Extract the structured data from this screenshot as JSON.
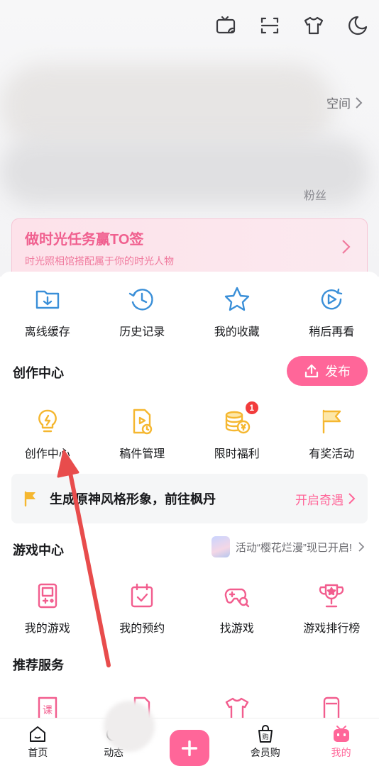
{
  "header": {
    "space_label": "空间",
    "fans_label": "粉丝"
  },
  "top_icons": [
    "tv-cast-icon",
    "scan-icon",
    "shirt-icon",
    "moon-icon"
  ],
  "promo": {
    "title": "做时光任务赢TO签",
    "subtitle": "时光照相馆搭配属于你的时光人物"
  },
  "quick_actions": [
    {
      "label": "离线缓存",
      "icon": "download-folder-icon"
    },
    {
      "label": "历史记录",
      "icon": "history-clock-icon"
    },
    {
      "label": "我的收藏",
      "icon": "star-icon"
    },
    {
      "label": "稍后再看",
      "icon": "watch-later-icon"
    }
  ],
  "creation": {
    "title": "创作中心",
    "publish_label": "发布",
    "items": [
      {
        "label": "创作中心",
        "icon": "lightbulb-icon"
      },
      {
        "label": "稿件管理",
        "icon": "video-file-icon"
      },
      {
        "label": "限时福利",
        "icon": "coins-icon",
        "badge": "1"
      },
      {
        "label": "有奖活动",
        "icon": "flag-icon"
      }
    ]
  },
  "banner": {
    "text": "生成原神风格形象，前往枫丹",
    "action": "开启奇遇"
  },
  "games": {
    "title": "游戏中心",
    "promo": "活动“樱花烂漫”现已开启!",
    "items": [
      {
        "label": "我的游戏",
        "icon": "gamepad-device-icon"
      },
      {
        "label": "我的预约",
        "icon": "calendar-check-icon"
      },
      {
        "label": "找游戏",
        "icon": "controller-search-icon"
      },
      {
        "label": "游戏排行榜",
        "icon": "trophy-icon"
      }
    ]
  },
  "services": {
    "title": "推荐服务",
    "icons": [
      "course-icon",
      "document-icon",
      "clothes-icon",
      "cup-icon"
    ]
  },
  "bottom_nav": [
    {
      "label": "首页",
      "icon": "home-icon"
    },
    {
      "label": "动态",
      "icon": "dynamic-icon"
    },
    {
      "label": "",
      "icon": "plus-icon"
    },
    {
      "label": "会员购",
      "icon": "shop-bag-icon"
    },
    {
      "label": "我的",
      "icon": "tv-face-icon"
    }
  ],
  "colors": {
    "accent": "#ff6699",
    "icon_blue": "#3a8fd8",
    "icon_yellow": "#f5b730",
    "icon_pink": "#f25d8e",
    "arrow": "#e84c4c"
  }
}
